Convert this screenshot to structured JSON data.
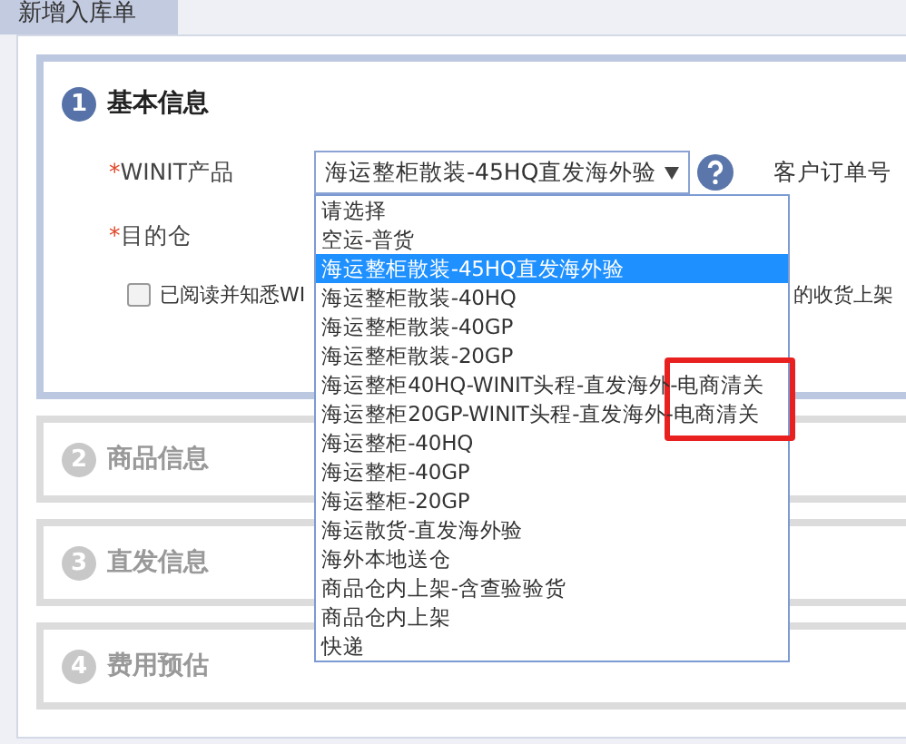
{
  "tab": {
    "label": "新增入库单",
    "selected": true
  },
  "sections": [
    {
      "number": "1",
      "title": "基本信息",
      "expanded": true
    },
    {
      "number": "2",
      "title": "商品信息",
      "expanded": false
    },
    {
      "number": "3",
      "title": "直发信息",
      "expanded": false
    },
    {
      "number": "4",
      "title": "费用预估",
      "expanded": false
    }
  ],
  "form": {
    "product_label": "WINIT产品",
    "required_mark": "*",
    "product_value": "海运整柜散装-45HQ直发海外验",
    "order_label": "客户订单号",
    "warehouse_label": "目的仓",
    "agree_text_start": "已阅读并知悉WI",
    "agree_text_end": "的收货上架",
    "agree_checked": false
  },
  "dropdown": {
    "options": [
      {
        "label": "请选择",
        "selected": false
      },
      {
        "label": "空运-普货",
        "selected": false
      },
      {
        "label": "海运整柜散装-45HQ直发海外验",
        "selected": true
      },
      {
        "label": "海运整柜散装-40HQ",
        "selected": false
      },
      {
        "label": "海运整柜散装-40GP",
        "selected": false
      },
      {
        "label": "海运整柜散装-20GP",
        "selected": false
      },
      {
        "label": "海运整柜40HQ-WINIT头程-直发海外-电商清关",
        "selected": false
      },
      {
        "label": "海运整柜20GP-WINIT头程-直发海外-电商清关",
        "selected": false
      },
      {
        "label": "海运整柜-40HQ",
        "selected": false
      },
      {
        "label": "海运整柜-40GP",
        "selected": false
      },
      {
        "label": "海运整柜-20GP",
        "selected": false
      },
      {
        "label": "海运散货-直发海外验",
        "selected": false
      },
      {
        "label": "海外本地送仓",
        "selected": false
      },
      {
        "label": "商品仓内上架-含查验验货",
        "selected": false
      },
      {
        "label": "商品仓内上架",
        "selected": false
      },
      {
        "label": "快递",
        "selected": false
      }
    ]
  }
}
